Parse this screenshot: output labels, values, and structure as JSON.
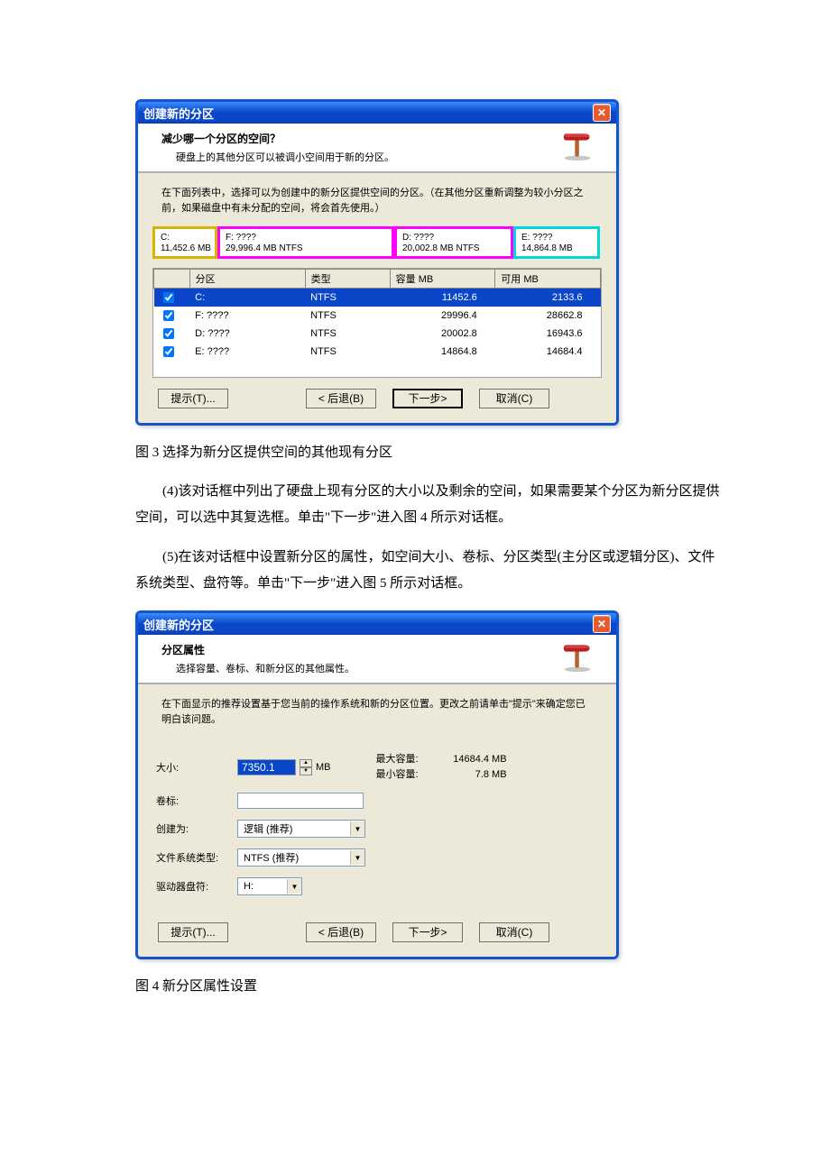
{
  "dialog1": {
    "title": "创建新的分区",
    "header_q": "减少哪一个分区的空间？",
    "header_sub": "硬盘上的其他分区可以被调小空间用于新的分区。",
    "instruction": "在下面列表中，选择可以为创建中的新分区提供空间的分区。（在其他分区重新调整为较小分区之前，如果磁盘中有未分配的空间，将会首先使用。）",
    "partitions_bar": {
      "c": {
        "label": "C:",
        "size": "11,452.6 MB"
      },
      "f": {
        "label": "F:   ????",
        "size": "29,996.4 MB    NTFS"
      },
      "d": {
        "label": "D:   ????",
        "size": "20,002.8 MB    NTFS"
      },
      "e": {
        "label": "E:   ????",
        "size": "14,864.8 MB"
      }
    },
    "table": {
      "headers": {
        "part": "分区",
        "type": "类型",
        "cap": "容量  MB",
        "avail": "可用  MB"
      },
      "rows": [
        {
          "part": "C:",
          "type": "NTFS",
          "cap": "11452.6",
          "avail": "2133.6"
        },
        {
          "part": "F:  ????",
          "type": "NTFS",
          "cap": "29996.4",
          "avail": "28662.8"
        },
        {
          "part": "D:  ????",
          "type": "NTFS",
          "cap": "20002.8",
          "avail": "16943.6"
        },
        {
          "part": "E:  ????",
          "type": "NTFS",
          "cap": "14864.8",
          "avail": "14684.4"
        }
      ]
    },
    "buttons": {
      "tips": "提示(T)...",
      "back": "< 后退(B)",
      "next": "下一步>",
      "cancel": "取消(C)"
    }
  },
  "caption1": "图 3 选择为新分区提供空间的其他现有分区",
  "para4": "(4)该对话框中列出了硬盘上现有分区的大小以及剩余的空间，如果需要某个分区为新分区提供空间，可以选中其复选框。单击\"下一步\"进入图 4 所示对话框。",
  "para5": "(5)在该对话框中设置新分区的属性，如空间大小、卷标、分区类型(主分区或逻辑分区)、文件系统类型、盘符等。单击\"下一步\"进入图 5 所示对话框。",
  "dialog2": {
    "title": "创建新的分区",
    "header_q": "分区属性",
    "header_sub": "选择容量、卷标、和新分区的其他属性。",
    "instruction": "在下面显示的推荐设置基于您当前的操作系统和新的分区位置。更改之前请单击\"提示\"来确定您已明白该问题。",
    "form": {
      "size_label": "大小:",
      "size_value": "7350.1",
      "size_unit": "MB",
      "max_label": "最大容量:",
      "max_value": "14684.4 MB",
      "min_label": "最小容量:",
      "min_value": "7.8 MB",
      "vol_label": "卷标:",
      "vol_value": "",
      "create_as_label": "创建为:",
      "create_as_value": "逻辑 (推荐)",
      "fs_label": "文件系统类型:",
      "fs_value": "NTFS (推荐)",
      "drive_label": "驱动器盘符:",
      "drive_value": "H:"
    },
    "buttons": {
      "tips": "提示(T)...",
      "back": "< 后退(B)",
      "next": "下一步>",
      "cancel": "取消(C)"
    }
  },
  "caption2": "图 4 新分区属性设置"
}
